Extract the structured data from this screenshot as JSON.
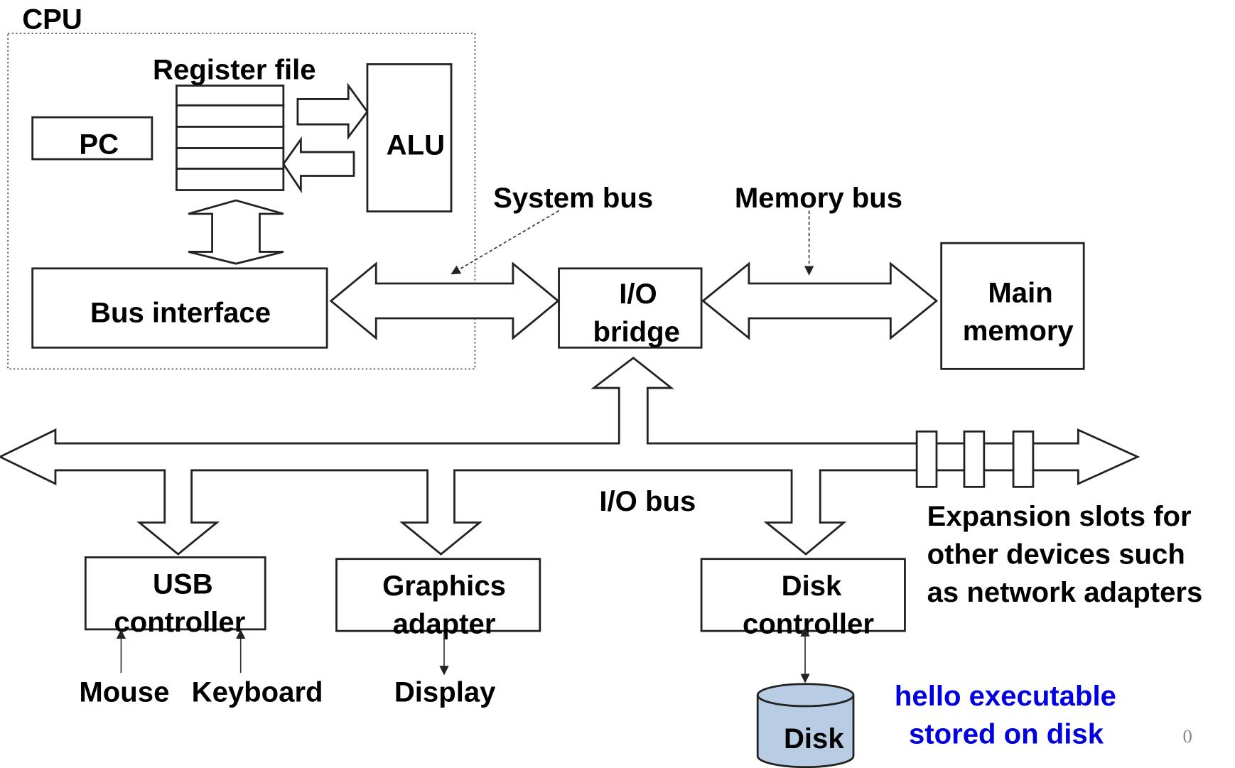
{
  "labels": {
    "cpu": "CPU",
    "register_file": "Register file",
    "pc": "PC",
    "alu": "ALU",
    "bus_interface": "Bus interface",
    "system_bus": "System bus",
    "memory_bus": "Memory bus",
    "io_bridge_1": "I/O",
    "io_bridge_2": "bridge",
    "main_memory_1": "Main",
    "main_memory_2": "memory",
    "io_bus": "I/O bus",
    "usb_1": "USB",
    "usb_2": "controller",
    "graphics_1": "Graphics",
    "graphics_2": "adapter",
    "disk_ctrl_1": "Disk",
    "disk_ctrl_2": "controller",
    "expansion_1": "Expansion slots for",
    "expansion_2": "other devices such",
    "expansion_3": "as network adapters",
    "mouse": "Mouse",
    "keyboard": "Keyboard",
    "display": "Display",
    "disk": "Disk",
    "hello_1": "hello executable",
    "hello_2": "stored on disk",
    "page_number": "0"
  },
  "colors": {
    "highlight_text": "#0000e0",
    "disk_fill": "#b8cce4"
  }
}
